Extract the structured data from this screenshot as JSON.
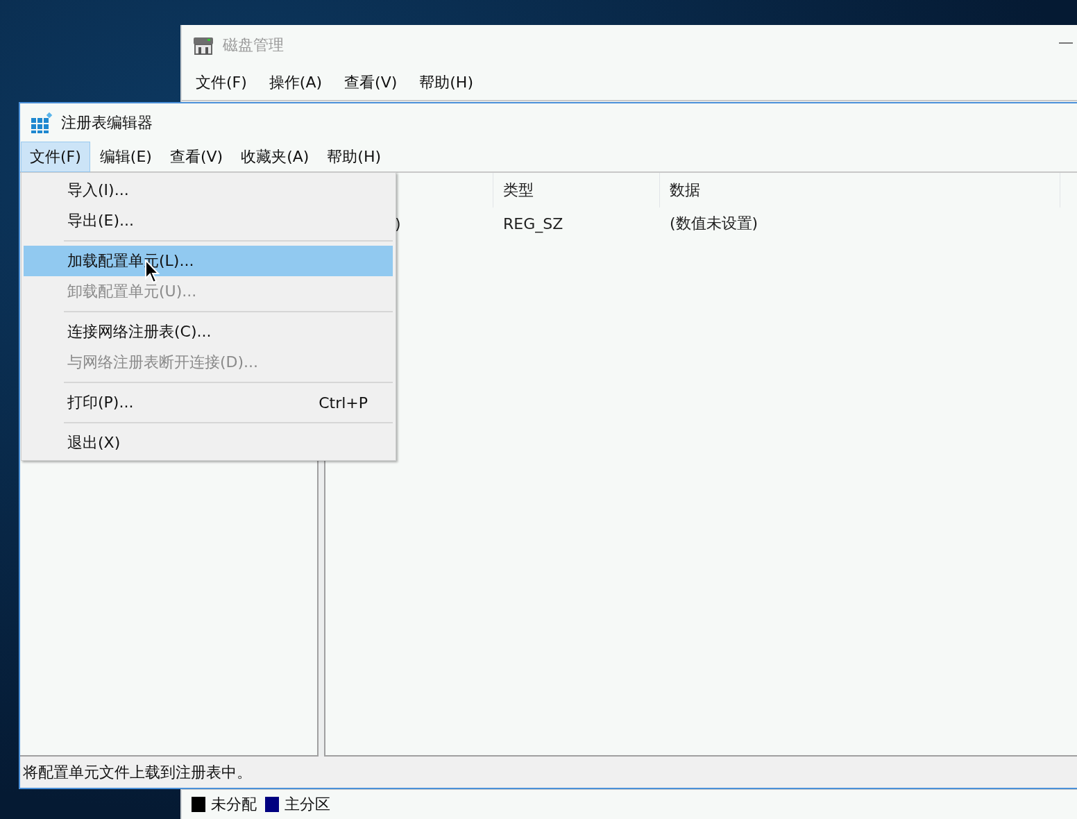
{
  "back_window": {
    "title": "磁盘管理",
    "menu": [
      {
        "label": "文件(F)"
      },
      {
        "label": "操作(A)"
      },
      {
        "label": "查看(V)"
      },
      {
        "label": "帮助(H)"
      }
    ],
    "legend": [
      {
        "label": "未分配",
        "color": "#000000"
      },
      {
        "label": "主分区",
        "color": "#000080"
      }
    ]
  },
  "window": {
    "title": "注册表编辑器",
    "menu": [
      {
        "label": "文件(F)",
        "selected": true
      },
      {
        "label": "编辑(E)",
        "selected": false
      },
      {
        "label": "查看(V)",
        "selected": false
      },
      {
        "label": "收藏夹(A)",
        "selected": false
      },
      {
        "label": "帮助(H)",
        "selected": false
      }
    ],
    "list": {
      "columns": [
        "类型",
        "数据"
      ],
      "rows": [
        {
          "column_1": ")",
          "type": "REG_SZ",
          "data": "(数值未设置)"
        }
      ]
    },
    "status_bar": "将配置单元文件上载到注册表中。"
  },
  "file_menu": [
    {
      "kind": "item",
      "label": "导入(I)...",
      "disabled": false,
      "selected": false
    },
    {
      "kind": "item",
      "label": "导出(E)...",
      "disabled": false,
      "selected": false
    },
    {
      "kind": "separator"
    },
    {
      "kind": "item",
      "label": "加载配置单元(L)...",
      "disabled": false,
      "selected": true
    },
    {
      "kind": "item",
      "label": "卸载配置单元(U)...",
      "disabled": true,
      "selected": false
    },
    {
      "kind": "separator"
    },
    {
      "kind": "item",
      "label": "连接网络注册表(C)...",
      "disabled": false,
      "selected": false
    },
    {
      "kind": "item",
      "label": "与网络注册表断开连接(D)...",
      "disabled": true,
      "selected": false
    },
    {
      "kind": "separator"
    },
    {
      "kind": "item",
      "label": "打印(P)...",
      "shortcut": "Ctrl+P",
      "disabled": false,
      "selected": false
    },
    {
      "kind": "separator"
    },
    {
      "kind": "item",
      "label": "退出(X)",
      "disabled": false,
      "selected": false
    }
  ]
}
